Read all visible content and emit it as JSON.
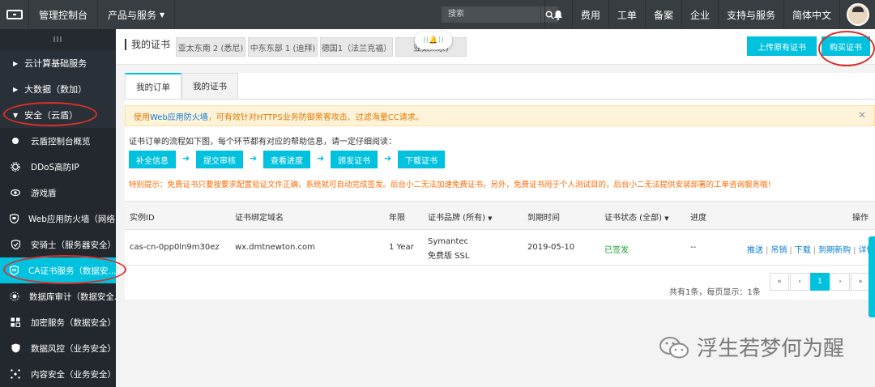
{
  "topbar": {
    "console": "管理控制台",
    "products": "产品与服务",
    "search_placeholder": "搜索",
    "links": [
      "费用",
      "工单",
      "备案",
      "企业",
      "支持与服务",
      "简体中文"
    ]
  },
  "sidebar": {
    "collapse": "III",
    "groups": [
      {
        "label": "云计算基础服务"
      },
      {
        "label": "大数据（数加）"
      },
      {
        "label": "安全（云盾）"
      }
    ],
    "items": [
      {
        "label": "云盾控制台概览",
        "icon": "dot-icon"
      },
      {
        "label": "DDoS高防IP",
        "icon": "gear-icon"
      },
      {
        "label": "游戏盾",
        "icon": "eye-icon"
      },
      {
        "label": "Web应用防火墙（网络...",
        "icon": "shield-icon"
      },
      {
        "label": "安骑士（服务器安全）",
        "icon": "shield-icon"
      },
      {
        "label": "CA证书服务（数据安...",
        "icon": "certificate-icon"
      },
      {
        "label": "数据库审计（数据安全...",
        "icon": "database-icon"
      },
      {
        "label": "加密服务（数据安全）",
        "icon": "grid-icon"
      },
      {
        "label": "数据风控（业务安全）",
        "icon": "shield-icon"
      },
      {
        "label": "内容安全（业务安全）",
        "icon": "network-icon"
      }
    ]
  },
  "header": {
    "title": "我的证书",
    "regions": [
      "亚太东南 2 (悉尼)",
      "中东东部 1 (迪拜)",
      "德国1（法兰克福）",
      "亚太...京)"
    ],
    "upload_btn": "上传原有证书",
    "buy_btn": "购买证书"
  },
  "tabs": [
    "我的订单",
    "我的证书"
  ],
  "alert": {
    "prefix": "使用",
    "link": "Web应用防火墙",
    "text": "，可有效针对HTTPS业务防御黑客攻击、过滤海量CC请求。"
  },
  "flow": {
    "desc": "证书订单的流程如下图，每个环节都有对应的帮助信息，请一定仔细阅读：",
    "steps": [
      "补全信息",
      "提交审核",
      "查看进度",
      "颁发证书",
      "下载证书"
    ]
  },
  "hint": "特别提示：免费证书只要按要求配置验证文件正确，系统就可自动完成签发。后台小二无法加速免费证书。另外，免费证书用于个人测试目的，后台小二无法提供安装部署的工单咨询服务哦！",
  "table": {
    "headers": [
      "实例ID",
      "证书绑定域名",
      "年限",
      "证书品牌 (所有)",
      "到期时间",
      "证书状态 (全部)",
      "进度",
      "操作"
    ],
    "row": {
      "id": "cas-cn-0pp0ln9m30ez",
      "domain": "wx.dmtnewton.com",
      "years": "1 Year",
      "brand1": "Symantec",
      "brand2": "免费版 SSL",
      "expire": "2019-05-10",
      "status": "已签发",
      "progress": "--",
      "ops": [
        "推送",
        "吊销",
        "下载",
        "到期新购",
        "详情"
      ]
    }
  },
  "pager": {
    "text": "共有1条，每页显示：1条",
    "buttons": [
      "«",
      "‹",
      "1",
      "›",
      "»"
    ]
  },
  "watermark": "浮生若梦何为醒",
  "colors": {
    "accent": "#00c1de",
    "topbar": "#373d41",
    "sidebar": "#293038",
    "annotation": "#d9302a"
  }
}
